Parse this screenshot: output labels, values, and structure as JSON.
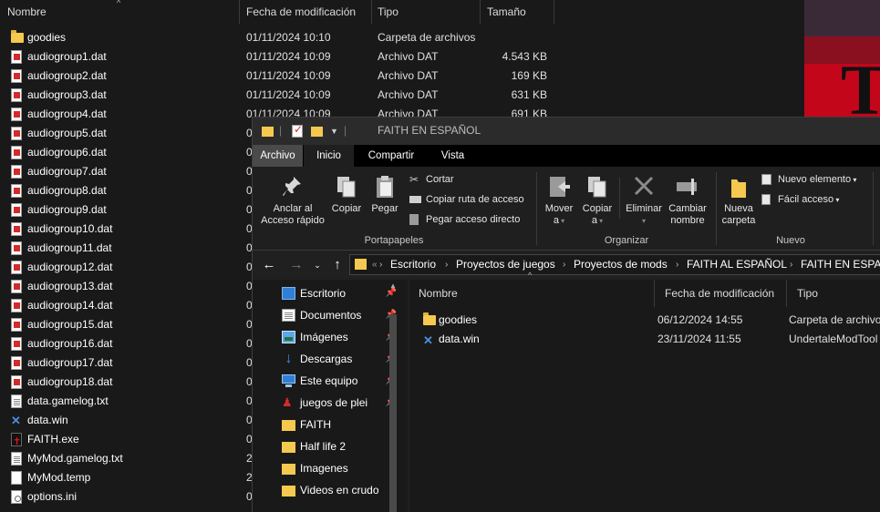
{
  "background_window": {
    "columns": {
      "name": "Nombre",
      "modified": "Fecha de modificación",
      "type": "Tipo",
      "size": "Tamaño"
    },
    "files": [
      {
        "icon": "folder-icon",
        "name": "goodies",
        "modified": "01/11/2024 10:10",
        "type": "Carpeta de archivos",
        "size": ""
      },
      {
        "icon": "dat-file-icon",
        "name": "audiogroup1.dat",
        "modified": "01/11/2024 10:09",
        "type": "Archivo DAT",
        "size": "4.543 KB"
      },
      {
        "icon": "dat-file-icon",
        "name": "audiogroup2.dat",
        "modified": "01/11/2024 10:09",
        "type": "Archivo DAT",
        "size": "169 KB"
      },
      {
        "icon": "dat-file-icon",
        "name": "audiogroup3.dat",
        "modified": "01/11/2024 10:09",
        "type": "Archivo DAT",
        "size": "631 KB"
      },
      {
        "icon": "dat-file-icon",
        "name": "audiogroup4.dat",
        "modified": "01/11/2024 10:09",
        "type": "Archivo DAT",
        "size": "691 KB"
      },
      {
        "icon": "dat-file-icon",
        "name": "audiogroup5.dat",
        "modified": "0",
        "type": "",
        "size": ""
      },
      {
        "icon": "dat-file-icon",
        "name": "audiogroup6.dat",
        "modified": "0",
        "type": "",
        "size": ""
      },
      {
        "icon": "dat-file-icon",
        "name": "audiogroup7.dat",
        "modified": "0",
        "type": "",
        "size": ""
      },
      {
        "icon": "dat-file-icon",
        "name": "audiogroup8.dat",
        "modified": "0",
        "type": "",
        "size": ""
      },
      {
        "icon": "dat-file-icon",
        "name": "audiogroup9.dat",
        "modified": "0",
        "type": "",
        "size": ""
      },
      {
        "icon": "dat-file-icon",
        "name": "audiogroup10.dat",
        "modified": "0",
        "type": "",
        "size": ""
      },
      {
        "icon": "dat-file-icon",
        "name": "audiogroup11.dat",
        "modified": "0",
        "type": "",
        "size": ""
      },
      {
        "icon": "dat-file-icon",
        "name": "audiogroup12.dat",
        "modified": "0",
        "type": "",
        "size": ""
      },
      {
        "icon": "dat-file-icon",
        "name": "audiogroup13.dat",
        "modified": "0",
        "type": "",
        "size": ""
      },
      {
        "icon": "dat-file-icon",
        "name": "audiogroup14.dat",
        "modified": "0",
        "type": "",
        "size": ""
      },
      {
        "icon": "dat-file-icon",
        "name": "audiogroup15.dat",
        "modified": "0",
        "type": "",
        "size": ""
      },
      {
        "icon": "dat-file-icon",
        "name": "audiogroup16.dat",
        "modified": "0",
        "type": "",
        "size": ""
      },
      {
        "icon": "dat-file-icon",
        "name": "audiogroup17.dat",
        "modified": "0",
        "type": "",
        "size": ""
      },
      {
        "icon": "dat-file-icon",
        "name": "audiogroup18.dat",
        "modified": "0",
        "type": "",
        "size": ""
      },
      {
        "icon": "text-file-icon",
        "name": "data.gamelog.txt",
        "modified": "0",
        "type": "",
        "size": ""
      },
      {
        "icon": "data-win-icon",
        "name": "data.win",
        "modified": "0",
        "type": "",
        "size": ""
      },
      {
        "icon": "game-exe-icon",
        "name": "FAITH.exe",
        "modified": "0",
        "type": "",
        "size": ""
      },
      {
        "icon": "text-file-icon",
        "name": "MyMod.gamelog.txt",
        "modified": "2",
        "type": "",
        "size": ""
      },
      {
        "icon": "temp-file-icon",
        "name": "MyMod.temp",
        "modified": "2",
        "type": "",
        "size": ""
      },
      {
        "icon": "ini-file-icon",
        "name": "options.ini",
        "modified": "0",
        "type": "",
        "size": ""
      }
    ]
  },
  "window": {
    "title": "FAITH EN ESPAÑOL",
    "tabs": [
      "Archivo",
      "Inicio",
      "Compartir",
      "Vista"
    ],
    "active_tab": "Inicio",
    "ribbon": {
      "pin_label_1": "Anclar al",
      "pin_label_2": "Acceso rápido",
      "copy_label": "Copiar",
      "paste_label": "Pegar",
      "cut_label": "Cortar",
      "copy_path_label": "Copiar ruta de acceso",
      "paste_shortcut_label": "Pegar acceso directo",
      "clipboard_group": "Portapapeles",
      "move_label_1": "Mover",
      "move_label_2": "a",
      "copyto_label_1": "Copiar",
      "copyto_label_2": "a",
      "delete_label": "Eliminar",
      "rename_label_1": "Cambiar",
      "rename_label_2": "nombre",
      "organize_group": "Organizar",
      "new_folder_label_1": "Nueva",
      "new_folder_label_2": "carpeta",
      "new_item_label": "Nuevo elemento",
      "easy_access_label": "Fácil acceso",
      "new_group": "Nuevo"
    },
    "address": {
      "more": "«",
      "crumbs": [
        "Escritorio",
        "Proyectos de juegos",
        "Proyectos de mods",
        "FAITH AL ESPAÑOL",
        "FAITH EN ESPAÑOL"
      ]
    },
    "nav_pane": [
      {
        "icon": "desktop-icon",
        "label": "Escritorio",
        "pinned": true
      },
      {
        "icon": "documents-icon",
        "label": "Documentos",
        "pinned": true
      },
      {
        "icon": "pictures-icon",
        "label": "Imágenes",
        "pinned": true
      },
      {
        "icon": "downloads-icon",
        "label": "Descargas",
        "pinned": true
      },
      {
        "icon": "this-pc-icon",
        "label": "Este equipo",
        "pinned": true
      },
      {
        "icon": "game-folder-icon",
        "label": "juegos de plei",
        "pinned": true
      },
      {
        "icon": "folder-icon",
        "label": "FAITH",
        "pinned": false
      },
      {
        "icon": "folder-icon",
        "label": "Half life 2",
        "pinned": false
      },
      {
        "icon": "folder-icon",
        "label": "Imagenes",
        "pinned": false
      },
      {
        "icon": "folder-icon",
        "label": "Videos en crudo",
        "pinned": false
      }
    ],
    "content": {
      "columns": {
        "name": "Nombre",
        "modified": "Fecha de modificación",
        "type": "Tipo"
      },
      "files": [
        {
          "icon": "folder-icon",
          "name": "goodies",
          "modified": "06/12/2024 14:55",
          "type": "Carpeta de archivos"
        },
        {
          "icon": "data-win-icon",
          "name": "data.win",
          "modified": "23/11/2024 11:55",
          "type": "UndertaleModTool"
        }
      ]
    }
  }
}
